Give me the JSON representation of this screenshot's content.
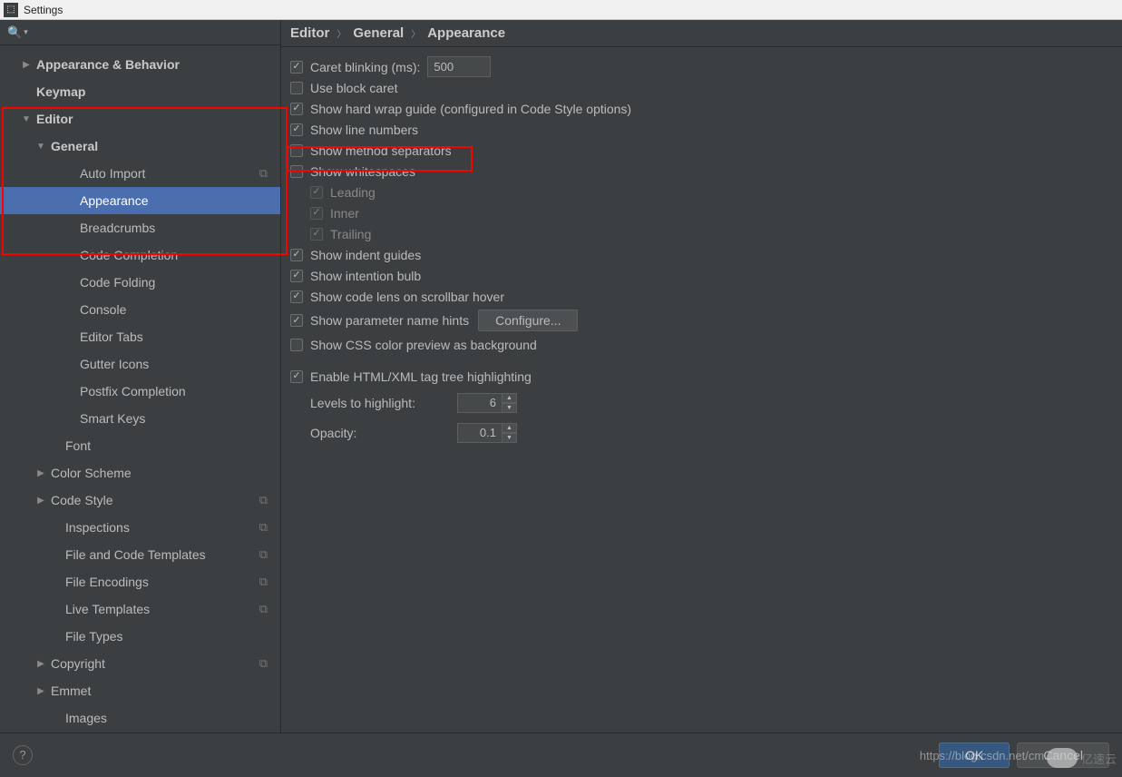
{
  "window": {
    "title": "Settings"
  },
  "breadcrumb": {
    "a": "Editor",
    "b": "General",
    "c": "Appearance"
  },
  "sidebar": {
    "items": [
      {
        "label": "Appearance & Behavior",
        "arrow": "collapsed",
        "indent": 0,
        "bold": true,
        "copy": false
      },
      {
        "label": "Keymap",
        "arrow": "none",
        "indent": 0,
        "bold": true,
        "copy": false
      },
      {
        "label": "Editor",
        "arrow": "expanded",
        "indent": 0,
        "bold": true,
        "copy": false
      },
      {
        "label": "General",
        "arrow": "expanded",
        "indent": 1,
        "bold": true,
        "copy": false
      },
      {
        "label": "Auto Import",
        "arrow": "none",
        "indent": 3,
        "bold": false,
        "copy": true
      },
      {
        "label": "Appearance",
        "arrow": "none",
        "indent": 3,
        "bold": false,
        "copy": false,
        "selected": true
      },
      {
        "label": "Breadcrumbs",
        "arrow": "none",
        "indent": 3,
        "bold": false,
        "copy": false
      },
      {
        "label": "Code Completion",
        "arrow": "none",
        "indent": 3,
        "bold": false,
        "copy": false
      },
      {
        "label": "Code Folding",
        "arrow": "none",
        "indent": 3,
        "bold": false,
        "copy": false
      },
      {
        "label": "Console",
        "arrow": "none",
        "indent": 3,
        "bold": false,
        "copy": false
      },
      {
        "label": "Editor Tabs",
        "arrow": "none",
        "indent": 3,
        "bold": false,
        "copy": false
      },
      {
        "label": "Gutter Icons",
        "arrow": "none",
        "indent": 3,
        "bold": false,
        "copy": false
      },
      {
        "label": "Postfix Completion",
        "arrow": "none",
        "indent": 3,
        "bold": false,
        "copy": false
      },
      {
        "label": "Smart Keys",
        "arrow": "none",
        "indent": 3,
        "bold": false,
        "copy": false
      },
      {
        "label": "Font",
        "arrow": "none",
        "indent": 2,
        "bold": false,
        "copy": false
      },
      {
        "label": "Color Scheme",
        "arrow": "collapsed",
        "indent": 1,
        "bold": false,
        "copy": false
      },
      {
        "label": "Code Style",
        "arrow": "collapsed",
        "indent": 1,
        "bold": false,
        "copy": true
      },
      {
        "label": "Inspections",
        "arrow": "none",
        "indent": 2,
        "bold": false,
        "copy": true
      },
      {
        "label": "File and Code Templates",
        "arrow": "none",
        "indent": 2,
        "bold": false,
        "copy": true
      },
      {
        "label": "File Encodings",
        "arrow": "none",
        "indent": 2,
        "bold": false,
        "copy": true
      },
      {
        "label": "Live Templates",
        "arrow": "none",
        "indent": 2,
        "bold": false,
        "copy": true
      },
      {
        "label": "File Types",
        "arrow": "none",
        "indent": 2,
        "bold": false,
        "copy": false
      },
      {
        "label": "Copyright",
        "arrow": "collapsed",
        "indent": 1,
        "bold": false,
        "copy": true
      },
      {
        "label": "Emmet",
        "arrow": "collapsed",
        "indent": 1,
        "bold": false,
        "copy": false
      },
      {
        "label": "Images",
        "arrow": "none",
        "indent": 2,
        "bold": false,
        "copy": false
      }
    ]
  },
  "settings": {
    "caret_blinking": {
      "label": "Caret blinking (ms):",
      "value": "500",
      "checked": true
    },
    "use_block_caret": {
      "label": "Use block caret",
      "checked": false
    },
    "show_hard_wrap": {
      "label": "Show hard wrap guide (configured in Code Style options)",
      "checked": true
    },
    "show_line_numbers": {
      "label": "Show line numbers",
      "checked": true
    },
    "show_method_sep": {
      "label": "Show method separators",
      "checked": false
    },
    "show_whitespaces": {
      "label": "Show whitespaces",
      "checked": false
    },
    "leading": {
      "label": "Leading",
      "checked": true
    },
    "inner": {
      "label": "Inner",
      "checked": true
    },
    "trailing": {
      "label": "Trailing",
      "checked": true
    },
    "indent_guides": {
      "label": "Show indent guides",
      "checked": true
    },
    "intention_bulb": {
      "label": "Show intention bulb",
      "checked": true
    },
    "code_lens": {
      "label": "Show code lens on scrollbar hover",
      "checked": true
    },
    "param_hints": {
      "label": "Show parameter name hints",
      "checked": true,
      "button": "Configure..."
    },
    "css_preview": {
      "label": "Show CSS color preview as background",
      "checked": false
    },
    "tag_tree": {
      "label": "Enable HTML/XML tag tree highlighting",
      "checked": true
    },
    "levels": {
      "label": "Levels to highlight:",
      "value": "6"
    },
    "opacity": {
      "label": "Opacity:",
      "value": "0.1"
    }
  },
  "footer": {
    "ok": "OK",
    "cancel": "Cancel"
  },
  "watermark": "https://blog.csdn.net/cm...",
  "logo_text": "亿速云"
}
